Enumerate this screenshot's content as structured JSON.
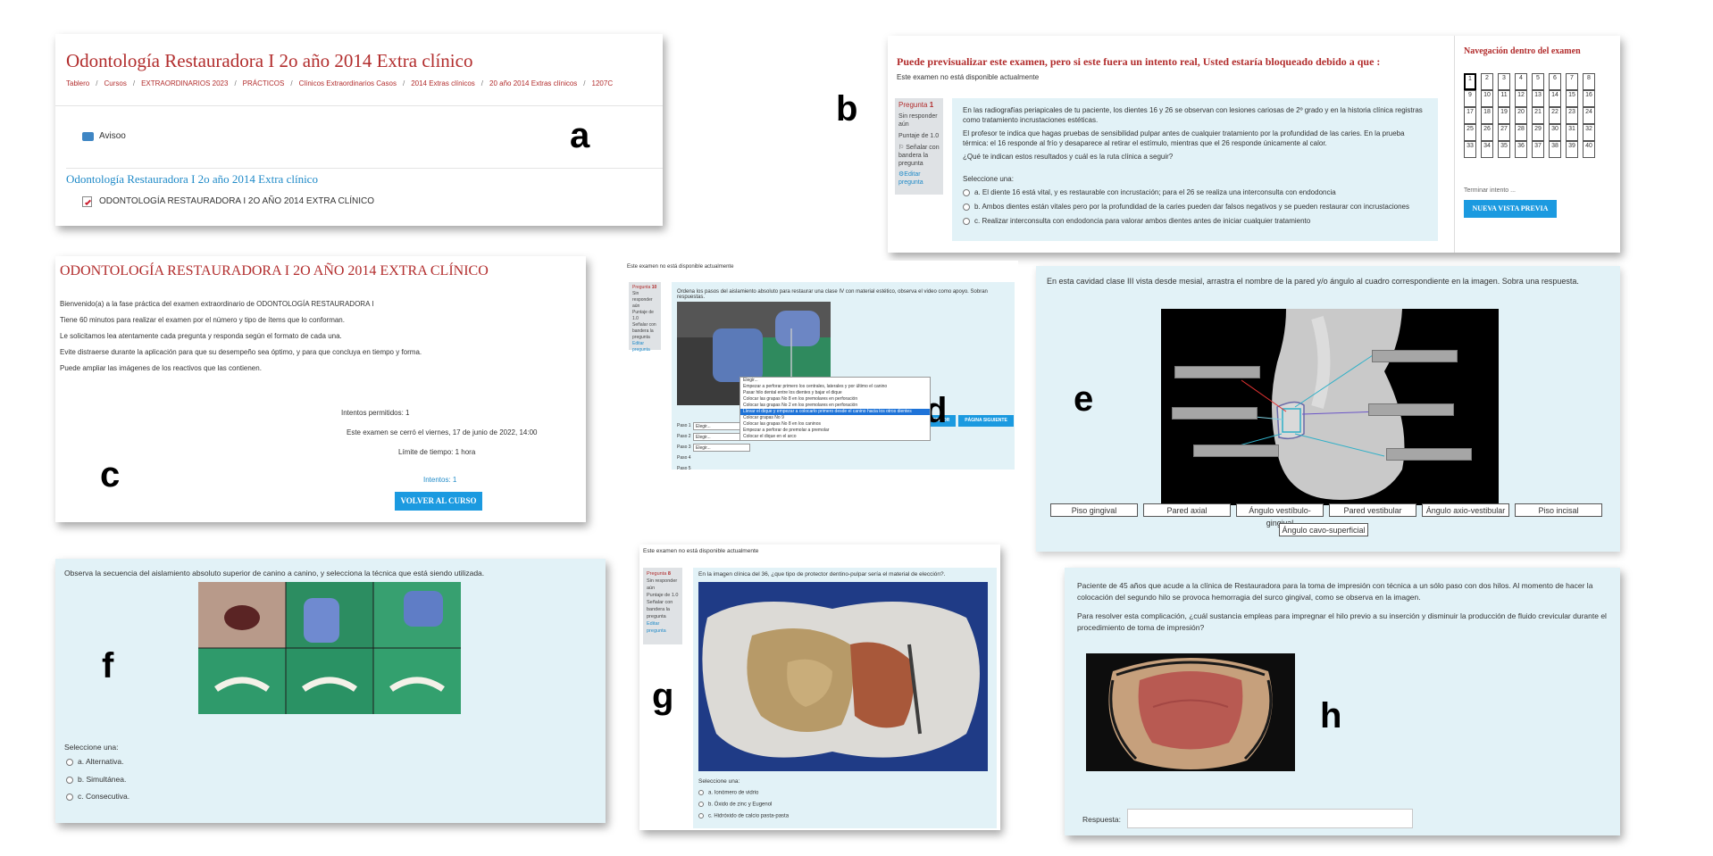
{
  "a": {
    "letter": "a",
    "title": "Odontología Restauradora I 2o año 2014 Extra clínico",
    "breadcrumb": [
      "Tablero",
      "Cursos",
      "EXTRAORDINARIOS 2023",
      "PRÁCTICOS",
      "Clínicos Extraordinarios Casos",
      "2014 Extras clínicos",
      "20 año 2014 Extras clínicos",
      "1207C"
    ],
    "separator": "/",
    "avisos": "Avisoo",
    "section_title": "Odontología Restauradora I 2o año 2014 Extra clínico",
    "quiz_item": "ODONTOLOGÍA RESTAURADORA I 2O AÑO 2014 EXTRA CLÍNICO"
  },
  "b": {
    "letter": "b",
    "heading": "Puede previsualizar este examen, pero si este fuera un intento real, Usted estaría bloqueado debido a que :",
    "not_available": "Este examen no está disponible actualmente",
    "question_label": "Pregunta",
    "question_num": "1",
    "side_status": "Sin responder aún",
    "side_score": "Puntaje de 1.0",
    "side_flag": "Señalar con bandera la pregunta",
    "side_edit": "Editar pregunta",
    "q_text_1": "En las radiografías periapicales de tu paciente, los dientes 16 y 26 se observan con lesiones cariosas de 2º grado y en la historia clínica registras como tratamiento incrustaciones estéticas.",
    "q_text_2": "El profesor te indica que hagas pruebas de sensibilidad pulpar antes de cualquier tratamiento por la profundidad de las caries. En la prueba térmica: el 16 responde al frío y desaparece al retirar el estímulo, mientras que el 26 responde únicamente al calor.",
    "q_text_3": "¿Qué te indican estos resultados y cuál es la ruta clínica a seguir?",
    "select_one": "Seleccione una:",
    "options": [
      "a. El diente 16 está vital, y es restaurable con incrustación; para el 26 se realiza una interconsulta con endodoncia",
      "b. Ambos dientes están vitales pero por la profundidad de la caries pueden dar falsos negativos y se pueden restaurar con incrustaciones",
      "c. Realizar interconsulta con endodoncia para valorar ambos dientes antes de iniciar cualquier tratamiento"
    ],
    "nav_title": "Navegación dentro del examen",
    "nav_numbers": [
      "1",
      "2",
      "3",
      "4",
      "5",
      "6",
      "7",
      "8",
      "9",
      "10",
      "11",
      "12",
      "13",
      "14",
      "15",
      "16",
      "17",
      "18",
      "19",
      "20",
      "21",
      "22",
      "23",
      "24",
      "25",
      "26",
      "27",
      "28",
      "29",
      "30",
      "31",
      "32",
      "33",
      "34",
      "35",
      "36",
      "37",
      "38",
      "39",
      "40"
    ],
    "finish_attempt": "Terminar intento ...",
    "new_preview": "NUEVA VISTA PREVIA"
  },
  "c": {
    "letter": "c",
    "title": "ODONTOLOGÍA RESTAURADORA I 2O AÑO 2014 EXTRA CLÍNICO",
    "paragraphs": [
      "Bienvenido(a) a la fase práctica del examen extraordinario de ODONTOLOGÍA RESTAURADORA I",
      "Tiene 60 minutos para realizar el examen por el número y tipo de ítems que lo conforman.",
      "Le solicitamos lea atentamente cada pregunta y responda según el formato de cada una.",
      "Evite distraerse durante la aplicación para que su desempeño sea óptimo, y para que concluya en tiempo y forma.",
      "Puede ampliar las imágenes de los reactivos que las contienen."
    ],
    "attempts_allowed": "Intentos permitidos: 1",
    "closed": "Este examen se cerró el viernes, 17 de junio de 2022, 14:00",
    "time_limit": "Límite de tiempo: 1 hora",
    "attempts_link": "Intentos: 1",
    "back_button": "VOLVER AL CURSO"
  },
  "d": {
    "letter": "d",
    "not_available": "Este examen no está disponible actualmente",
    "question_label": "Pregunta",
    "question_num": "10",
    "side_status": "Sin responder aún",
    "side_score": "Puntaje de 1.0",
    "side_flag": "Señalar con bandera la pregunta",
    "side_edit": "Editar pregunta",
    "q_text": "Ordena los pasos del aislamiento absoluto para restaurar una clase IV con material estético, observa el video como apoyo. Sobran respuestas.",
    "steps": [
      "Paso 1",
      "Paso 2",
      "Paso 3",
      "Paso 4",
      "Paso 5"
    ],
    "choose": "Elegir...",
    "dropdown_options": [
      "Elegir...",
      "Empezar a perforar primero los centrales, laterales y por último el canino",
      "Pasar hilo dental entre los dientes y bajar el dique",
      "Colocar las grapas No 8 en los premolares en perforación",
      "Colocar las grapas No 2 en los premolares en perforación",
      "Llevar el dique y empezar a colocarlo primero desde el canino hacia los otros dientes",
      "Colocar grapas No 9",
      "Colocar las grapas No 8 en los caninos",
      "Empezar a perforar de premolar a premolar",
      "Colocar el dique en el arco"
    ],
    "selected_index": 5,
    "prev_page": "PÁGINA ANTERIOR",
    "next_page": "PÁGINA SIGUIENTE"
  },
  "e": {
    "letter": "e",
    "q_text": "En esta cavidad clase III vista desde mesial, arrastra el nombre de la pared y/o ángulo al cuadro correspondiente en la imagen. Sobra una respuesta.",
    "words": [
      "Piso gingival",
      "Pared axial",
      "Ángulo vestíbulo-gingival",
      "Pared vestibular",
      "Ángulo axio-vestibular",
      "Piso incisal",
      "Ángulo cavo-superficial"
    ]
  },
  "f": {
    "letter": "f",
    "q_text": "Observa la secuencia del aislamiento absoluto superior de canino a canino, y selecciona la técnica que está siendo utilizada.",
    "select_one": "Seleccione una:",
    "options": [
      "a. Alternativa.",
      "b. Simultánea.",
      "c. Consecutiva."
    ]
  },
  "g": {
    "letter": "g",
    "not_available": "Este examen no está disponible actualmente",
    "question_label": "Pregunta",
    "question_num": "8",
    "side_status": "Sin responder aún",
    "side_score": "Puntaje de 1.0",
    "side_flag": "Señalar con bandera la pregunta",
    "side_edit": "Editar pregunta",
    "q_text": "En la imagen clínica del 36, ¿que tipo de protector dentino-pulpar sería el material de elección?.",
    "select_one": "Seleccione una:",
    "options": [
      "a. Ionómero de vidrio",
      "b. Óxido de zinc y Eugenol",
      "c. Hidróxido de calcio pasta-pasta"
    ]
  },
  "h": {
    "letter": "h",
    "q_text_1": "Paciente de 45 años que acude a la clínica de Restauradora para la toma de impresión con técnica a un sólo paso con dos hilos. Al momento de hacer la colocación del segundo hilo se provoca hemorragia del surco gingival, como se observa en la imagen.",
    "q_text_2": "Para resolver esta complicación, ¿cuál sustancia empleas para impregnar el hilo previo a su inserción y disminuir la producción de fluido crevicular durante el procedimiento de toma de impresión?",
    "answer_label": "Respuesta:"
  },
  "colors": {
    "moodle_red": "#b22d2d",
    "link_blue": "#1f8ac8",
    "button_blue": "#1b9ae0",
    "question_bg": "#e2f2f7"
  }
}
